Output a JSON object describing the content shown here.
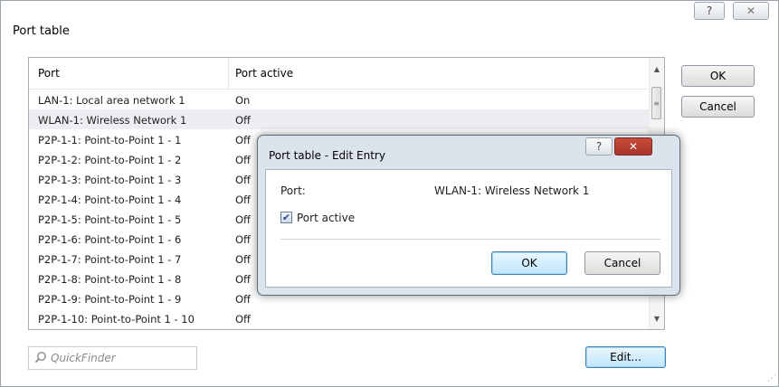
{
  "window": {
    "title": "Port table",
    "help_label": "?",
    "close_label": "✕"
  },
  "table": {
    "columns": [
      "Port",
      "Port active"
    ],
    "rows": [
      {
        "port": "LAN-1: Local area network 1",
        "active": "On"
      },
      {
        "port": "WLAN-1: Wireless Network 1",
        "active": "Off"
      },
      {
        "port": "P2P-1-1: Point-to-Point 1 - 1",
        "active": "Off"
      },
      {
        "port": "P2P-1-2: Point-to-Point 1 - 2",
        "active": "Off"
      },
      {
        "port": "P2P-1-3: Point-to-Point 1 - 3",
        "active": "Off"
      },
      {
        "port": "P2P-1-4: Point-to-Point 1 - 4",
        "active": "Off"
      },
      {
        "port": "P2P-1-5: Point-to-Point 1 - 5",
        "active": "Off"
      },
      {
        "port": "P2P-1-6: Point-to-Point 1 - 6",
        "active": "Off"
      },
      {
        "port": "P2P-1-7: Point-to-Point 1 - 7",
        "active": "Off"
      },
      {
        "port": "P2P-1-8: Point-to-Point 1 - 8",
        "active": "Off"
      },
      {
        "port": "P2P-1-9: Point-to-Point 1 - 9",
        "active": "Off"
      },
      {
        "port": "P2P-1-10: Point-to-Point 1 - 10",
        "active": "Off"
      }
    ],
    "selected_row": 1
  },
  "buttons": {
    "ok": "OK",
    "cancel": "Cancel",
    "edit": "Edit..."
  },
  "quickfinder": {
    "placeholder": "QuickFinder",
    "icon": "search-icon"
  },
  "edit_dialog": {
    "title": "Port table - Edit Entry",
    "port_label": "Port:",
    "port_value": "WLAN-1: Wireless Network 1",
    "port_active_label": "Port active",
    "port_active_checked": true,
    "ok": "OK",
    "cancel": "Cancel",
    "help_label": "?",
    "close_label": "✕",
    "close_color": "#c94a3a"
  }
}
